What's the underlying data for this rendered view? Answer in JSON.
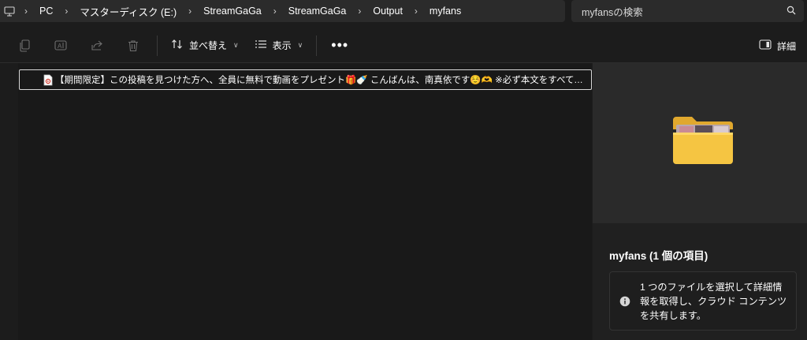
{
  "address_bar": {
    "breadcrumbs": [
      "PC",
      "マスターディスク (E:)",
      "StreamGaGa",
      "StreamGaGa",
      "Output",
      "myfans"
    ]
  },
  "search": {
    "placeholder": "myfansの検索"
  },
  "toolbar": {
    "sort_label": "並べ替え",
    "view_label": "表示",
    "more_label": "•••",
    "details_label": "詳細"
  },
  "files": [
    {
      "name": "【期間限定】この投稿を見つけた方へ、全員に無料で動画をプレゼント🎁🍼 こんばんは、南真依です☺️🫶 ※必ず本文をすべてお読みのうえ、ご参加ください..."
    }
  ],
  "details": {
    "title": "myfans (1 個の項目)",
    "message": "1 つのファイルを選択して詳細情報を取得し、クラウド コンテンツを共有します。"
  },
  "colors": {
    "background": "#1c1c1c",
    "address_box": "#2b2b2b",
    "folder_yellow": "#f5c542"
  }
}
